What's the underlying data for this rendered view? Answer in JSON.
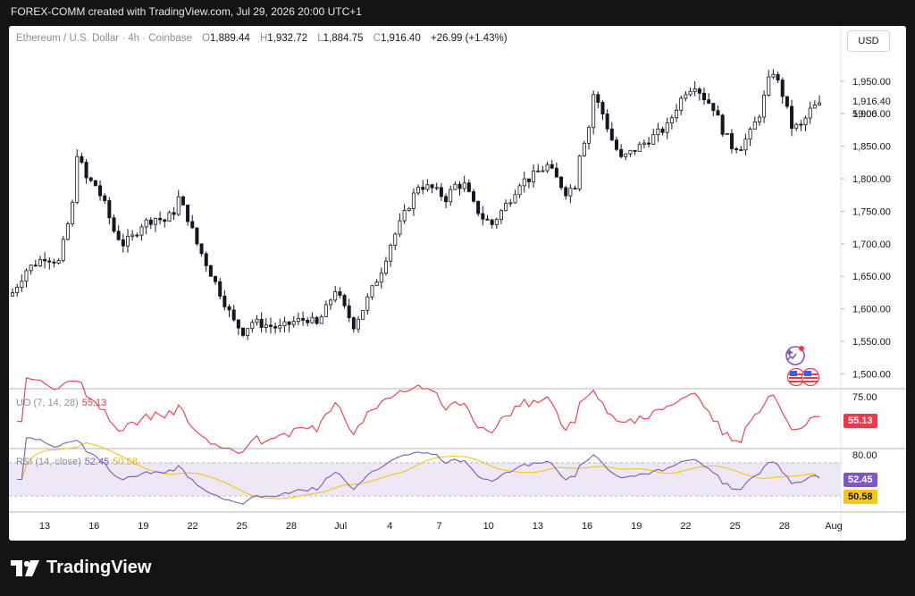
{
  "header": {
    "caption": "FOREX-COMM created with TradingView.com, Jul 29, 2026 20:00 UTC+1"
  },
  "legend": {
    "symbol": "Ethereum / U.S. Dollar · 4h · Coinbase",
    "o_key": "O",
    "o_val": "1,889.44",
    "h_key": "H",
    "h_val": "1,932.72",
    "l_key": "L",
    "l_val": "1,884.75",
    "c_key": "C",
    "c_val": "1,916.40",
    "change": "+26.99 (+1.43%)"
  },
  "currency": "USD",
  "last_price": {
    "price": "1,916.40",
    "countdown": "59:06"
  },
  "uo": {
    "title": "UO (7, 14, 28)",
    "value": "55.13",
    "axis_top": "75.00",
    "color": "#f23645"
  },
  "rsi": {
    "title": "RSI (14, close)",
    "value": "52.45",
    "ma_value": "50.58",
    "axis_top": "80.00",
    "color": "#7e57c2",
    "ma_color": "#f5c518",
    "band_color": "#ede7f6"
  },
  "brand": {
    "logo_text": "TradingView"
  },
  "chart_data": [
    {
      "type": "candlestick",
      "title": "Ethereum / U.S. Dollar · 4h · Coinbase",
      "ylim": [
        1480,
        1980
      ],
      "yticks": [
        1500,
        1550,
        1600,
        1650,
        1700,
        1750,
        1800,
        1850,
        1900,
        1950
      ],
      "ytick_labels": [
        "1,500.00",
        "1,550.00",
        "1,600.00",
        "1,650.00",
        "1,700.00",
        "1,750.00",
        "1,800.00",
        "1,850.00",
        "1,900.00",
        "1,950.00"
      ],
      "xtick_labels": [
        "13",
        "16",
        "19",
        "22",
        "25",
        "28",
        "Jul",
        "4",
        "7",
        "10",
        "13",
        "16",
        "19",
        "22",
        "25",
        "28",
        "Aug"
      ],
      "close_path": [
        [
          0,
          1625
        ],
        [
          3,
          1660
        ],
        [
          7,
          1680
        ],
        [
          10,
          1672
        ],
        [
          11,
          1700
        ],
        [
          13,
          1760
        ],
        [
          14,
          1840
        ],
        [
          16,
          1800
        ],
        [
          18,
          1790
        ],
        [
          20,
          1760
        ],
        [
          22,
          1720
        ],
        [
          24,
          1700
        ],
        [
          26,
          1710
        ],
        [
          28,
          1730
        ],
        [
          31,
          1740
        ],
        [
          33,
          1735
        ],
        [
          35,
          1750
        ],
        [
          36,
          1770
        ],
        [
          38,
          1740
        ],
        [
          40,
          1700
        ],
        [
          42,
          1670
        ],
        [
          44,
          1640
        ],
        [
          46,
          1610
        ],
        [
          48,
          1580
        ],
        [
          50,
          1565
        ],
        [
          52,
          1580
        ],
        [
          55,
          1575
        ],
        [
          58,
          1570
        ],
        [
          61,
          1580
        ],
        [
          64,
          1585
        ],
        [
          66,
          1575
        ],
        [
          68,
          1600
        ],
        [
          70,
          1630
        ],
        [
          72,
          1600
        ],
        [
          74,
          1575
        ],
        [
          76,
          1600
        ],
        [
          78,
          1630
        ],
        [
          80,
          1660
        ],
        [
          82,
          1700
        ],
        [
          84,
          1730
        ],
        [
          86,
          1760
        ],
        [
          88,
          1790
        ],
        [
          91,
          1785
        ],
        [
          94,
          1770
        ],
        [
          96,
          1790
        ],
        [
          98,
          1790
        ],
        [
          100,
          1760
        ],
        [
          102,
          1740
        ],
        [
          104,
          1730
        ],
        [
          106,
          1750
        ],
        [
          108,
          1770
        ],
        [
          110,
          1795
        ],
        [
          112,
          1800
        ],
        [
          114,
          1810
        ],
        [
          116,
          1820
        ],
        [
          118,
          1800
        ],
        [
          120,
          1780
        ],
        [
          122,
          1790
        ],
        [
          123,
          1840
        ],
        [
          125,
          1880
        ],
        [
          126,
          1930
        ],
        [
          128,
          1900
        ],
        [
          130,
          1860
        ],
        [
          132,
          1830
        ],
        [
          134,
          1840
        ],
        [
          136,
          1850
        ],
        [
          138,
          1860
        ],
        [
          140,
          1870
        ],
        [
          142,
          1880
        ],
        [
          144,
          1910
        ],
        [
          146,
          1935
        ],
        [
          148,
          1945
        ],
        [
          150,
          1925
        ],
        [
          152,
          1910
        ],
        [
          154,
          1875
        ],
        [
          156,
          1850
        ],
        [
          158,
          1850
        ],
        [
          160,
          1870
        ],
        [
          162,
          1900
        ],
        [
          164,
          1950
        ],
        [
          165,
          1965
        ],
        [
          167,
          1930
        ],
        [
          169,
          1880
        ],
        [
          171,
          1880
        ],
        [
          173,
          1905
        ],
        [
          175,
          1916.4
        ]
      ]
    },
    {
      "type": "line",
      "title": "UO (7, 14, 28)",
      "series": [
        {
          "name": "UO",
          "values": [
            55.13
          ]
        }
      ],
      "ylim": [
        20,
        85
      ]
    },
    {
      "type": "line",
      "title": "RSI (14, close)",
      "series": [
        {
          "name": "RSI",
          "values": [
            52.45
          ]
        },
        {
          "name": "MA",
          "values": [
            50.58
          ]
        }
      ],
      "band": [
        30,
        70
      ],
      "ylim": [
        15,
        85
      ]
    }
  ]
}
